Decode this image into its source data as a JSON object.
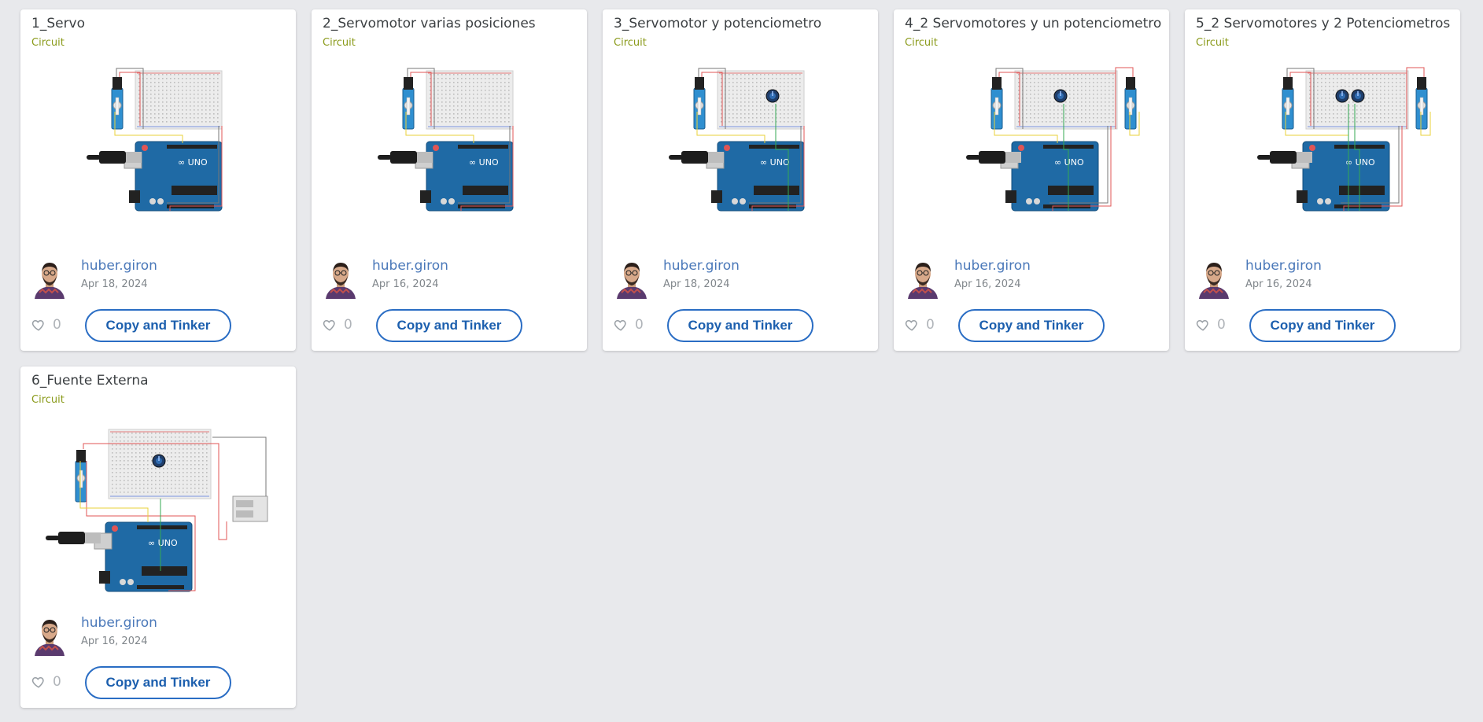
{
  "cards": [
    {
      "title": "1_Servo",
      "type": "Circuit",
      "author": "huber.giron",
      "date": "Apr 18, 2024",
      "likes": "0",
      "button": "Copy and Tinker",
      "pots": 0,
      "servos": 1,
      "external_supply": false
    },
    {
      "title": "2_Servomotor varias posiciones",
      "type": "Circuit",
      "author": "huber.giron",
      "date": "Apr 16, 2024",
      "likes": "0",
      "button": "Copy and Tinker",
      "pots": 0,
      "servos": 1,
      "external_supply": false
    },
    {
      "title": "3_Servomotor y potenciometro",
      "type": "Circuit",
      "author": "huber.giron",
      "date": "Apr 18, 2024",
      "likes": "0",
      "button": "Copy and Tinker",
      "pots": 1,
      "servos": 1,
      "external_supply": false
    },
    {
      "title": "4_2 Servomotores y un potenciometro",
      "type": "Circuit",
      "author": "huber.giron",
      "date": "Apr 16, 2024",
      "likes": "0",
      "button": "Copy and Tinker",
      "pots": 1,
      "servos": 2,
      "external_supply": false
    },
    {
      "title": "5_2 Servomotores y 2 Potenciometros",
      "type": "Circuit",
      "author": "huber.giron",
      "date": "Apr 16, 2024",
      "likes": "0",
      "button": "Copy and Tinker",
      "pots": 2,
      "servos": 2,
      "external_supply": false
    },
    {
      "title": "6_Fuente Externa",
      "type": "Circuit",
      "author": "huber.giron",
      "date": "Apr 16, 2024",
      "likes": "0",
      "button": "Copy and Tinker",
      "pots": 1,
      "servos": 1,
      "external_supply": true
    }
  ],
  "icons": {
    "like": "heart-outline-icon",
    "avatar": "user-avatar-icon"
  },
  "colors": {
    "accent": "#2a6dc4",
    "author": "#4a78b9",
    "type_label": "#8a9a1a",
    "background": "#e8e9ec",
    "arduino": "#1f6aa5"
  }
}
